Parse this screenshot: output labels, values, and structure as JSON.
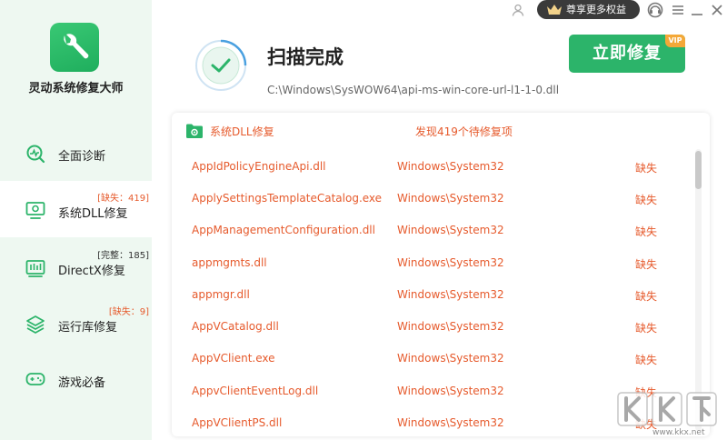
{
  "app": {
    "name": "灵动系统修复大师"
  },
  "topbar": {
    "vip_button_label": "尊享更多权益"
  },
  "scan": {
    "title": "扫描完成",
    "path": "C:\\Windows\\SysWOW64\\api-ms-win-core-url-l1-1-0.dll",
    "repair_button": "立即修复",
    "vip_tag": "VIP"
  },
  "sidebar": {
    "items": [
      {
        "label": "全面诊断",
        "badge": ""
      },
      {
        "label": "系统DLL修复",
        "badge": "[缺失：419]"
      },
      {
        "label": "DirectX修复",
        "badge": "[完整：185]"
      },
      {
        "label": "运行库修复",
        "badge": "[缺失：9]"
      },
      {
        "label": "游戏必备",
        "badge": ""
      }
    ]
  },
  "panel": {
    "title": "系统DLL修复",
    "summary": "发现419个待修复项",
    "rows": [
      {
        "name": "AppIdPolicyEngineApi.dll",
        "path": "Windows\\System32",
        "status": "缺失"
      },
      {
        "name": "ApplySettingsTemplateCatalog.exe",
        "path": "Windows\\System32",
        "status": "缺失"
      },
      {
        "name": "AppManagementConfiguration.dll",
        "path": "Windows\\System32",
        "status": "缺失"
      },
      {
        "name": "appmgmts.dll",
        "path": "Windows\\System32",
        "status": "缺失"
      },
      {
        "name": "appmgr.dll",
        "path": "Windows\\System32",
        "status": "缺失"
      },
      {
        "name": "AppVCatalog.dll",
        "path": "Windows\\System32",
        "status": "缺失"
      },
      {
        "name": "AppVClient.exe",
        "path": "Windows\\System32",
        "status": "缺失"
      },
      {
        "name": "AppvClientEventLog.dll",
        "path": "Windows\\System32",
        "status": "缺失"
      },
      {
        "name": "AppVClientPS.dll",
        "path": "Windows\\System32",
        "status": "缺失"
      }
    ]
  },
  "watermark": {
    "text": "www.kkx.net"
  },
  "colors": {
    "accent": "#2cb46a",
    "warning": "#e65a2c",
    "sidebar_bg": "#eef8f1"
  }
}
